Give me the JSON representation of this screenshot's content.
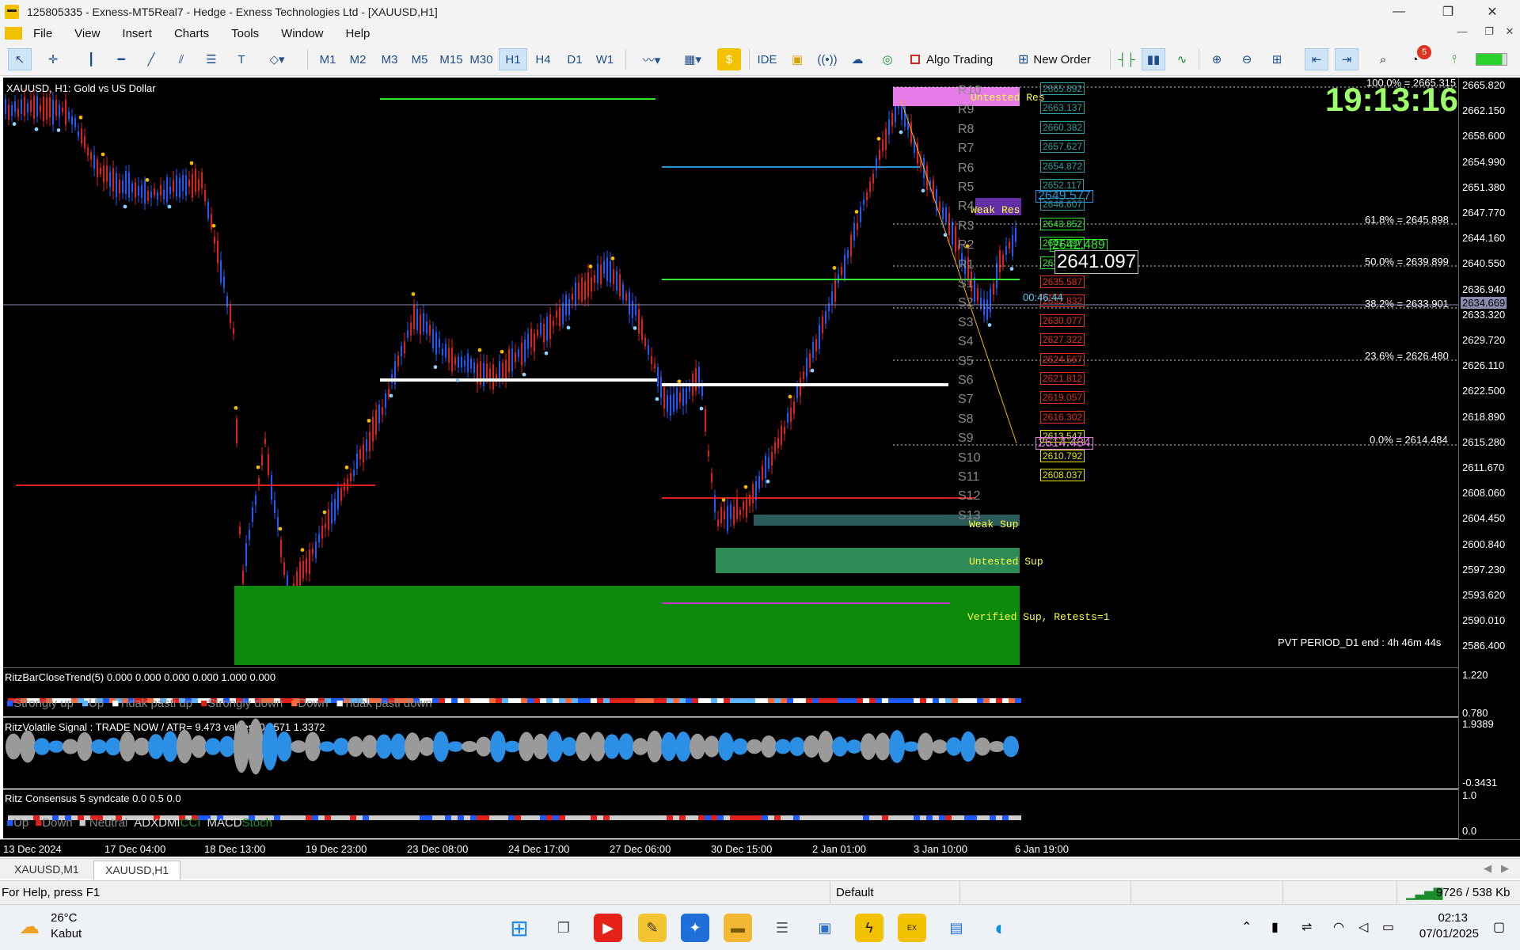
{
  "window": {
    "title": "125805335 - Exness-MT5Real7 - Hedge - Exness Technologies Ltd - [XAUUSD,H1]",
    "minimize": "—",
    "restore": "❐",
    "close": "✕"
  },
  "menu": [
    "File",
    "View",
    "Insert",
    "Charts",
    "Tools",
    "Window",
    "Help"
  ],
  "toolbar": {
    "timeframes": [
      "M1",
      "M2",
      "M3",
      "M5",
      "M15",
      "M30",
      "H1",
      "H4",
      "D1",
      "W1"
    ],
    "selected_timeframe": "H1",
    "ide": "IDE",
    "algo_trading": "Algo Trading",
    "new_order": "New Order",
    "badge": "5"
  },
  "chart": {
    "symbol_label": "XAUUSD, H1:  Gold vs US Dollar",
    "clock": "19:13:16",
    "current_price_label": "2641.097",
    "bid_box": "2642.489",
    "ask_box": "2649.577",
    "low_box": "2614.484",
    "countdown": "00:46:44",
    "pvt_text": "PVT PERIOD_D1 end : 4h 46m 44s",
    "zones": {
      "untested_res": "Untested Res",
      "weak_res": "Weak Res",
      "weak_sup": "Weak Sup",
      "untested_sup": "Untested Sup",
      "verified_sup": "Verified Sup, Retests=1"
    },
    "fib": {
      "f100": "100.0% = 2665.315",
      "f618": "61.8% = 2645.898",
      "f50": "50.0% = 2639.899",
      "f382": "38.2% = 2633.901",
      "f236": "23.6% = 2626.480",
      "f0": "0.0% = 2614.484"
    },
    "levels": [
      {
        "name": "R10",
        "price": "2665.892"
      },
      {
        "name": "R9",
        "price": "2663.137"
      },
      {
        "name": "R8",
        "price": "2660.382"
      },
      {
        "name": "R7",
        "price": "2657.627"
      },
      {
        "name": "R6",
        "price": "2654.872"
      },
      {
        "name": "R5",
        "price": "2652.117"
      },
      {
        "name": "R4",
        "price": "2646.607"
      },
      {
        "name": "R3",
        "price": "2643.852"
      },
      {
        "name": "R2",
        "price": "2641.097"
      },
      {
        "name": "R1",
        "price": "2638.342"
      },
      {
        "name": "S1",
        "price": "2635.587"
      },
      {
        "name": "S2",
        "price": "2632.832"
      },
      {
        "name": "S3",
        "price": "2630.077"
      },
      {
        "name": "S4",
        "price": "2627.322"
      },
      {
        "name": "S5",
        "price": "2624.567"
      },
      {
        "name": "S6",
        "price": "2621.812"
      },
      {
        "name": "S7",
        "price": "2619.057"
      },
      {
        "name": "S8",
        "price": "2616.302"
      },
      {
        "name": "S9",
        "price": "2613.547"
      },
      {
        "name": "S10",
        "price": "2610.792"
      },
      {
        "name": "S11",
        "price": "2608.037"
      },
      {
        "name": "S12",
        "price": ""
      },
      {
        "name": "S13",
        "price": ""
      }
    ],
    "price_axis": [
      "2665.820",
      "2662.150",
      "2658.600",
      "2654.990",
      "2651.380",
      "2647.770",
      "2644.160",
      "2640.550",
      "2636.940",
      "2633.320",
      "2629.720",
      "2626.110",
      "2622.500",
      "2618.890",
      "2615.280",
      "2611.670",
      "2608.060",
      "2604.450",
      "2600.840",
      "2597.230",
      "2593.620",
      "2590.010",
      "2586.400"
    ],
    "current_price_axis": "2634.669"
  },
  "indicators": {
    "trend": {
      "title": "RitzBarCloseTrend(5) 0.000 0.000 0.000 0.000 1.000 0.000",
      "legend": [
        "Strongly up",
        "Up",
        "Tidak pasti up",
        "Strongly down",
        "Down",
        "Tidak pasti down"
      ],
      "scale_top": "1.220",
      "scale_bottom": "0.780"
    },
    "volatile": {
      "title": "RitzVolatile Signal : TRADE NOW  /  ATR= 9.473    values: 0.9571 1.3372",
      "scale_top": "1.9389",
      "scale_bottom": "-0.3431"
    },
    "consensus": {
      "title": "Ritz Consensus 5 syndcate 0.0 0.5 0.0",
      "legend": [
        "Up",
        "Down",
        "Neutral",
        "ADXDMI",
        "CCI",
        "MACD",
        "Stoch"
      ],
      "scale_top": "1.0",
      "scale_bottom": "0.0"
    }
  },
  "time_axis": [
    "13 Dec 2024",
    "17 Dec 04:00",
    "18 Dec 13:00",
    "19 Dec 23:00",
    "23 Dec 08:00",
    "24 Dec 17:00",
    "27 Dec 06:00",
    "30 Dec 15:00",
    "2 Jan 01:00",
    "3 Jan 10:00",
    "6 Jan 19:00"
  ],
  "tabs": [
    "XAUUSD,M1",
    "XAUUSD,H1"
  ],
  "status": {
    "help": "For Help, press F1",
    "profile": "Default",
    "traffic": "9726 / 538 Kb"
  },
  "taskbar": {
    "weather_temp": "26°C",
    "weather_desc": "Kabut",
    "time": "02:13",
    "date": "07/01/2025"
  },
  "colors": {
    "bull": "#1e5bff",
    "bear": "#e0201a",
    "sar": "#f5b800",
    "sup_green": "#2e8b57",
    "clock_green": "#9cff6a"
  }
}
